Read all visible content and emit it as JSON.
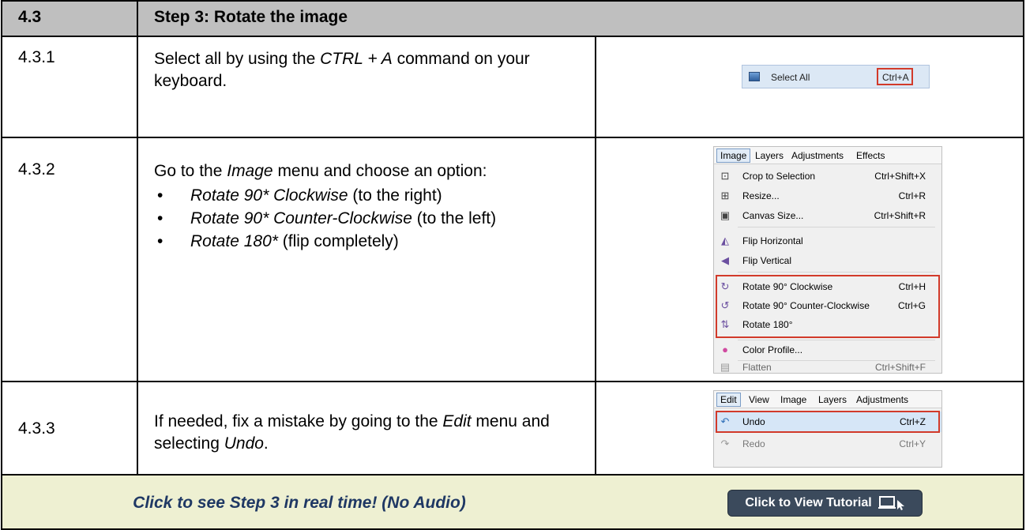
{
  "header": {
    "number": "4.3",
    "title": "Step 3: Rotate the image"
  },
  "rows": [
    {
      "number": "4.3.1",
      "text_parts": [
        "Select all by using the ",
        "CTRL + A",
        " command on your keyboard."
      ],
      "snippet": {
        "label": "Select All",
        "shortcut": "Ctrl+A"
      }
    },
    {
      "number": "4.3.2",
      "text_parts": [
        "Go to the ",
        "Image",
        " menu and choose an option:"
      ],
      "bullets": [
        {
          "em": "Rotate 90* Clockwise",
          "rest": " (to the right)"
        },
        {
          "em": "Rotate 90* Counter-Clockwise",
          "rest": " (to the left)"
        },
        {
          "em": "Rotate 180*",
          "rest": " (flip completely)"
        }
      ],
      "menu": {
        "bar": [
          "Image",
          "Layers",
          "Adjustments",
          "Effects"
        ],
        "items": [
          {
            "icon": "crop-icon",
            "label": "Crop to Selection",
            "shortcut": "Ctrl+Shift+X"
          },
          {
            "icon": "resize-icon",
            "label": "Resize...",
            "shortcut": "Ctrl+R"
          },
          {
            "icon": "canvas-size-icon",
            "label": "Canvas Size...",
            "shortcut": "Ctrl+Shift+R"
          },
          {
            "icon": "flip-horizontal-icon",
            "label": "Flip Horizontal",
            "shortcut": ""
          },
          {
            "icon": "flip-vertical-icon",
            "label": "Flip Vertical",
            "shortcut": ""
          },
          {
            "icon": "rotate-cw-icon",
            "label": "Rotate 90° Clockwise",
            "shortcut": "Ctrl+H"
          },
          {
            "icon": "rotate-ccw-icon",
            "label": "Rotate 90° Counter-Clockwise",
            "shortcut": "Ctrl+G"
          },
          {
            "icon": "rotate-180-icon",
            "label": "Rotate 180°",
            "shortcut": ""
          },
          {
            "icon": "color-profile-icon",
            "label": "Color Profile...",
            "shortcut": ""
          },
          {
            "icon": "flatten-icon",
            "label": "Flatten",
            "shortcut": "Ctrl+Shift+F"
          }
        ]
      }
    },
    {
      "number": "4.3.3",
      "text_parts": [
        "If needed, fix a mistake by going to the ",
        "Edit",
        " menu and selecting ",
        "Undo",
        "."
      ],
      "menu": {
        "bar": [
          "Edit",
          "View",
          "Image",
          "Layers",
          "Adjustments"
        ],
        "items": [
          {
            "icon": "undo-icon",
            "label": "Undo",
            "shortcut": "Ctrl+Z"
          },
          {
            "icon": "redo-icon",
            "label": "Redo",
            "shortcut": "Ctrl+Y"
          }
        ]
      }
    }
  ],
  "footer": {
    "message": "Click to see Step 3 in real time! (No Audio)",
    "button_label": "Click to View Tutorial"
  },
  "colors": {
    "header_bg": "#bfbfbf",
    "footer_bg": "#eef0d2",
    "footer_text": "#1f3864",
    "highlight_border": "#d23a2a",
    "button_bg": "#3b4a5c"
  }
}
